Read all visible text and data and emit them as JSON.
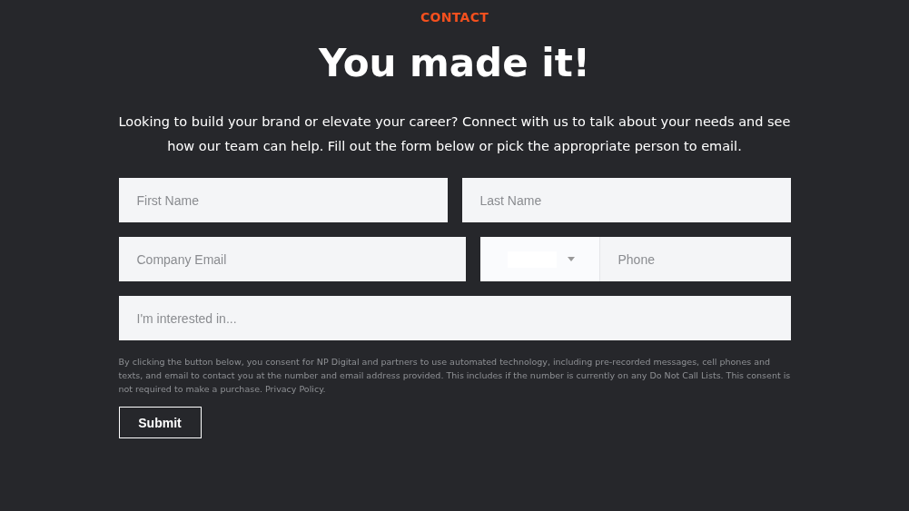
{
  "eyebrow": "CONTACT",
  "heading": "You made it!",
  "intro": "Looking to build your brand or elevate your career? Connect with us to talk about your needs and see how our team can help. Fill out the form below or pick the appropriate person to email.",
  "form": {
    "first_name": {
      "placeholder": "First Name"
    },
    "last_name": {
      "placeholder": "Last Name"
    },
    "email": {
      "placeholder": "Company Email"
    },
    "phone": {
      "placeholder": "Phone"
    },
    "interest": {
      "placeholder": "I'm interested in..."
    }
  },
  "consent": {
    "text": "By clicking the button below, you consent for NP Digital and partners to use automated technology, including pre-recorded messages, cell phones and texts, and email to contact you at the number and email address provided. This includes if the number is currently on any Do Not Call Lists. This consent is not required to make a purchase.",
    "link": "Privacy Policy."
  },
  "submit": "Submit"
}
